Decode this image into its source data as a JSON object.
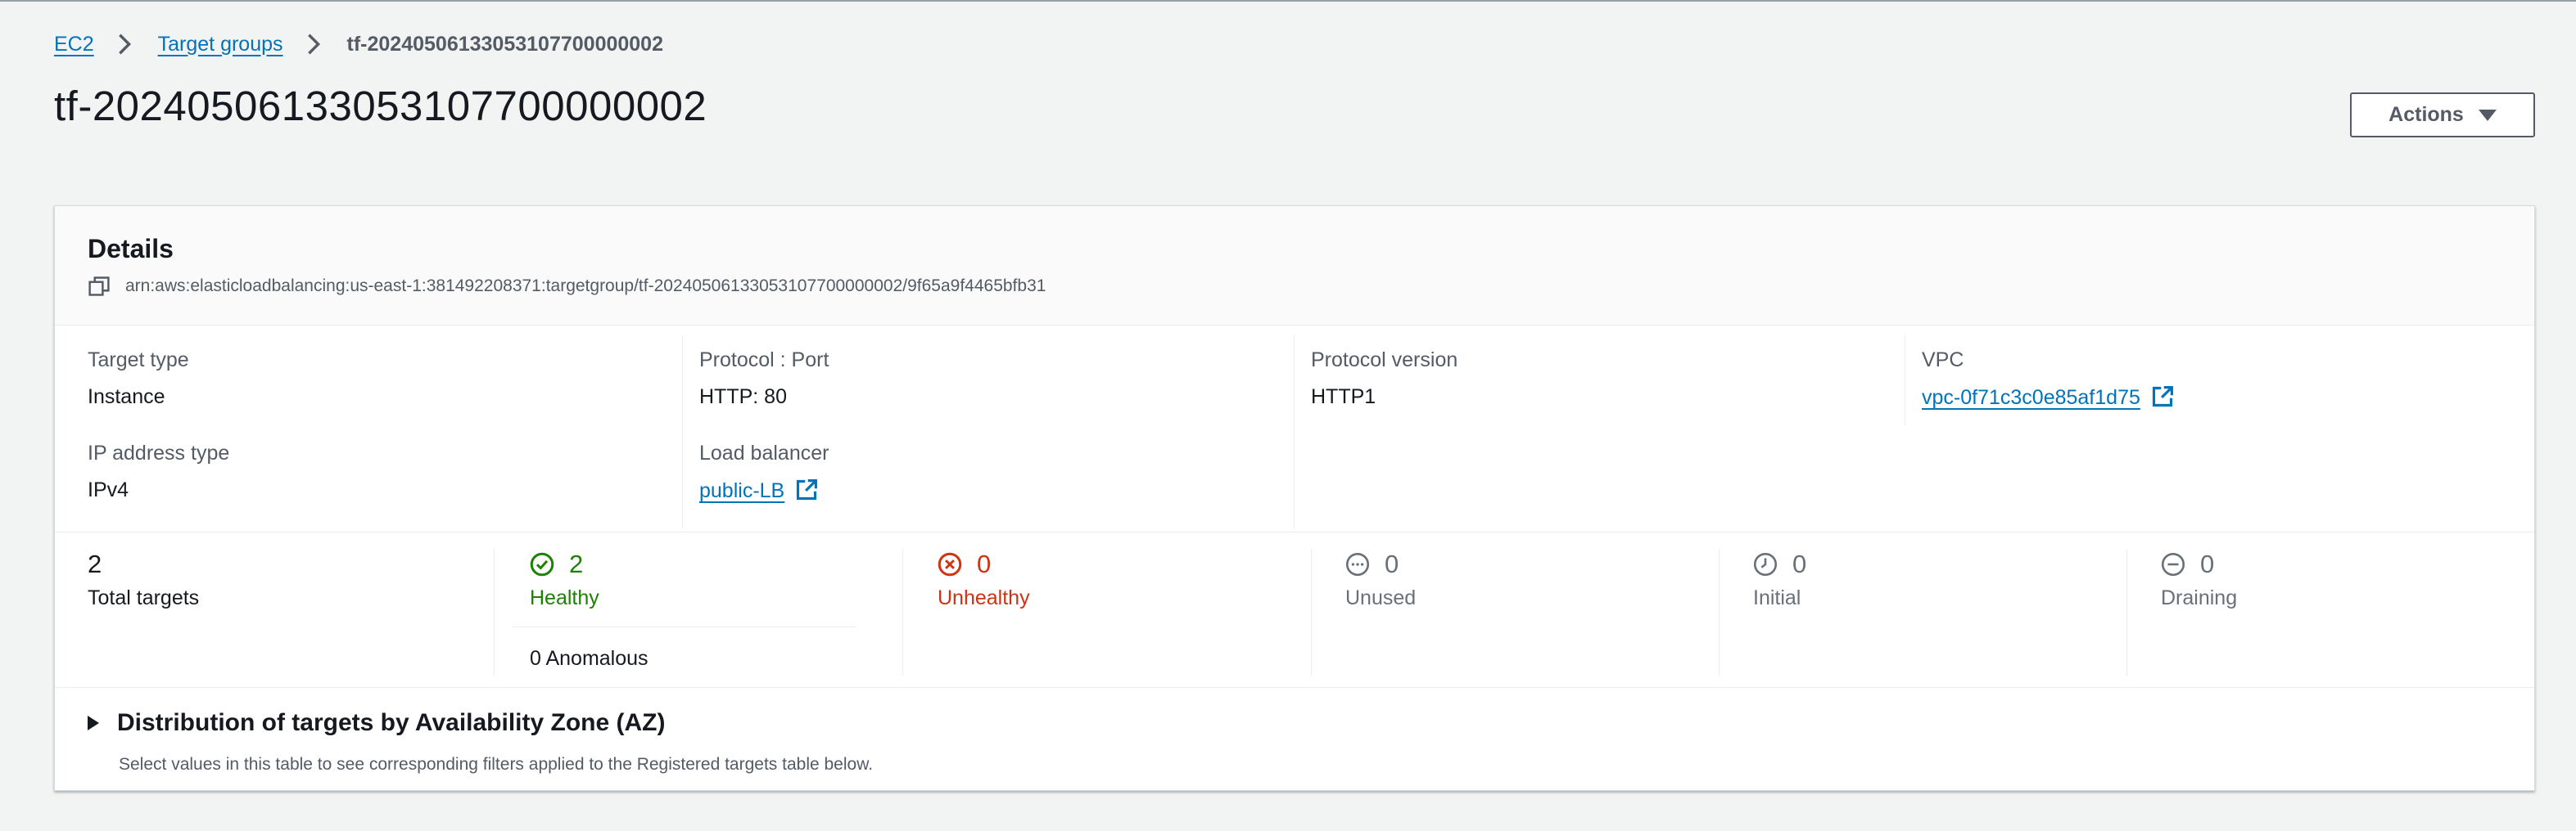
{
  "breadcrumb": {
    "items": [
      "EC2",
      "Target groups"
    ],
    "current": "tf-20240506133053107700000002"
  },
  "page": {
    "title": "tf-20240506133053107700000002",
    "actions_label": "Actions"
  },
  "details": {
    "title": "Details",
    "arn": "arn:aws:elasticloadbalancing:us-east-1:381492208371:targetgroup/tf-20240506133053107700000002/9f65a9f4465bfb31",
    "fields": {
      "target_type": {
        "label": "Target type",
        "value": "Instance"
      },
      "protocol_port": {
        "label": "Protocol : Port",
        "value": "HTTP: 80"
      },
      "protocol_version": {
        "label": "Protocol version",
        "value": "HTTP1"
      },
      "vpc": {
        "label": "VPC",
        "value": "vpc-0f71c3c0e85af1d75"
      },
      "ip_address_type": {
        "label": "IP address type",
        "value": "IPv4"
      },
      "load_balancer": {
        "label": "Load balancer",
        "value": "public-LB"
      }
    }
  },
  "targets": {
    "total": {
      "count": "2",
      "label": "Total targets"
    },
    "healthy": {
      "count": "2",
      "label": "Healthy"
    },
    "anomalous": "0 Anomalous",
    "unhealthy": {
      "count": "0",
      "label": "Unhealthy"
    },
    "unused": {
      "count": "0",
      "label": "Unused"
    },
    "initial": {
      "count": "0",
      "label": "Initial"
    },
    "draining": {
      "count": "0",
      "label": "Draining"
    }
  },
  "distribution": {
    "title": "Distribution of targets by Availability Zone (AZ)",
    "description": "Select values in this table to see corresponding filters applied to the Registered targets table below."
  },
  "colors": {
    "link": "#0073bb",
    "healthy": "#1d8102",
    "unhealthy": "#d13212",
    "neutral": "#687078"
  },
  "icons": [
    "chevron-right-icon",
    "caret-down-icon",
    "copy-icon",
    "external-link-icon",
    "check-circle-icon",
    "x-circle-icon",
    "ellipsis-circle-icon",
    "clock-icon",
    "minus-circle-icon",
    "caret-right-icon"
  ]
}
